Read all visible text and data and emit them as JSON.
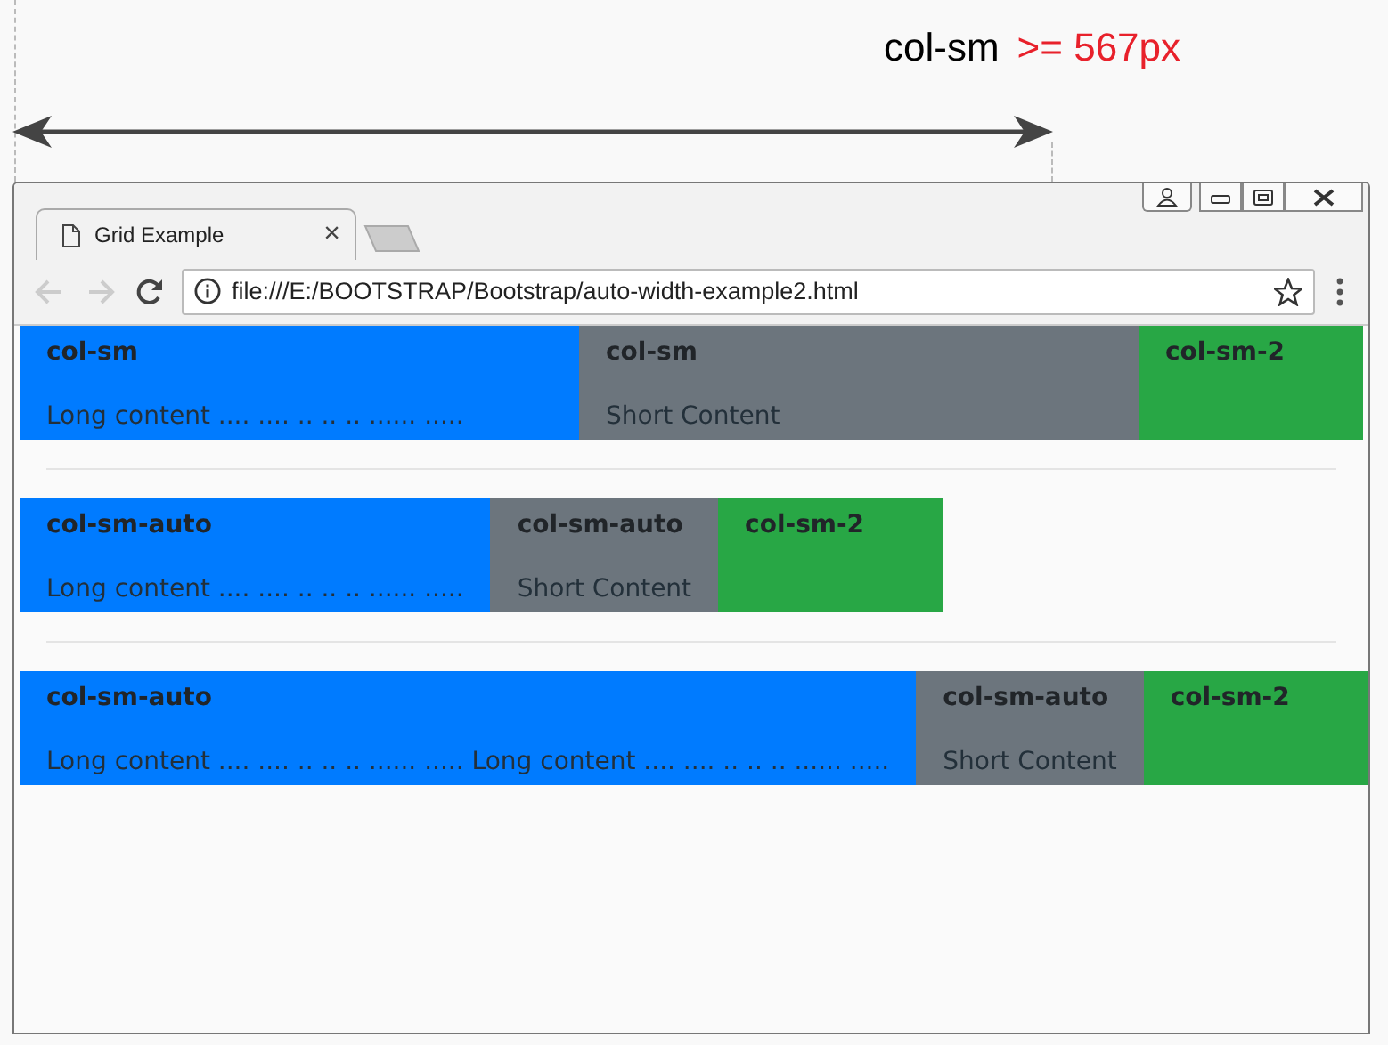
{
  "diagram": {
    "label": "col-sm",
    "breakpoint": ">= 567px"
  },
  "browser": {
    "tab": {
      "title": "Grid Example",
      "close": "×",
      "selected": true
    },
    "back_disabled": true,
    "forward_disabled": true,
    "url": "file:///E:/BOOTSTRAP/Bootstrap/auto-width-example2.html"
  },
  "rows": [
    {
      "columns": [
        {
          "kind": "equal",
          "title": "col-sm",
          "content": "Long content .... .... .. .. .. ...... .....",
          "color": "#007bff"
        },
        {
          "kind": "equal",
          "title": "col-sm",
          "content": "Short Content",
          "color": "#6c757d"
        },
        {
          "kind": "fixed",
          "title": "col-sm-2",
          "color": "#28a745"
        }
      ]
    },
    {
      "columns": [
        {
          "kind": "auto",
          "title": "col-sm-auto",
          "content": "Long content .... .... .. .. .. ...... .....",
          "color": "#007bff"
        },
        {
          "kind": "auto",
          "title": "col-sm-auto",
          "content": "Short Content",
          "color": "#6c757d"
        },
        {
          "kind": "fixed",
          "title": "col-sm-2",
          "color": "#28a745"
        }
      ]
    },
    {
      "columns": [
        {
          "kind": "auto",
          "title": "col-sm-auto",
          "content": "Long content .... .... .. .. .. ...... ..... Long content .... .... .. .. .. ...... .....",
          "color": "#007bff"
        },
        {
          "kind": "auto",
          "title": "col-sm-auto",
          "content": "Short Content",
          "color": "#6c757d"
        },
        {
          "kind": "fixed",
          "title": "col-sm-2",
          "color": "#28a745"
        }
      ]
    }
  ]
}
